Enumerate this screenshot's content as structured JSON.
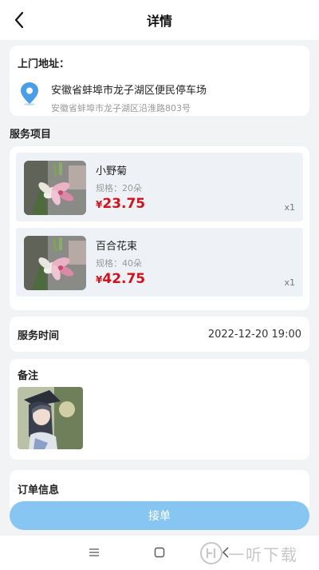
{
  "header": {
    "title": "详情"
  },
  "address": {
    "label": "上门地址：",
    "main": "安徽省蚌埠市龙子湖区便民停车场",
    "detail": "安徽省蚌埠市龙子湖区沿淮路803号"
  },
  "services": {
    "label": "服务项目",
    "items": [
      {
        "name": "小野菊",
        "spec": "规格：20朵",
        "currency": "¥",
        "price": "23.75",
        "qty": "x1"
      },
      {
        "name": "百合花束",
        "spec": "规格：40朵",
        "currency": "¥",
        "price": "42.75",
        "qty": "x1"
      }
    ]
  },
  "service_time": {
    "label": "服务时间",
    "value": "2022-12-20 19:00"
  },
  "notes": {
    "label": "备注"
  },
  "order_info": {
    "label": "订单信息"
  },
  "actions": {
    "accept_label": "接单"
  },
  "watermark": {
    "text": "一听下载"
  },
  "colors": {
    "accent": "#87c6f2",
    "price": "#d0121b",
    "background": "#f2f3f5"
  }
}
